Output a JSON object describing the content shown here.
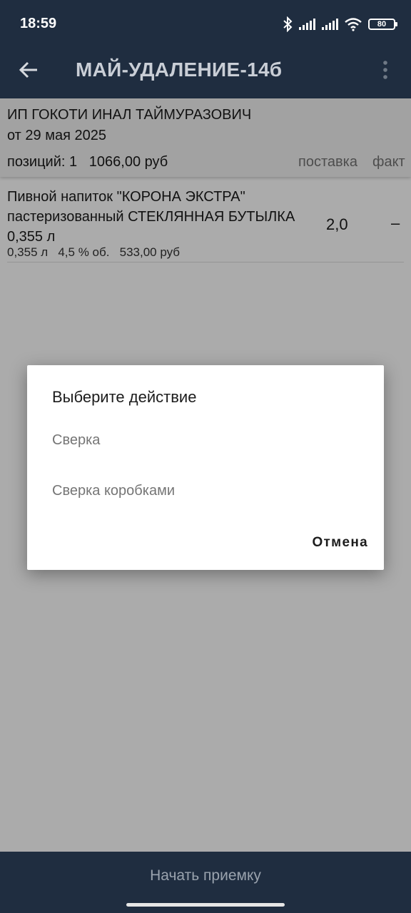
{
  "status_bar": {
    "time": "18:59",
    "battery": "80",
    "icons": [
      "bluetooth-icon",
      "signal-icon",
      "signal-icon",
      "wifi-icon",
      "battery-icon"
    ]
  },
  "app_bar": {
    "title": "МАЙ-УДАЛЕНИЕ-14б",
    "back_icon": "arrow-left-icon",
    "menu_icon": "more-vertical-icon"
  },
  "document": {
    "supplier": "ИП ГОКОТИ ИНАЛ ТАЙМУРАЗОВИЧ",
    "date": "от 29 мая 2025",
    "summary": "позиций: 1   1066,00 руб",
    "column_supply": "поставка",
    "column_fact": "факт"
  },
  "items": [
    {
      "name": "Пивной напиток \"КОРОНА ЭКСТРА\" пастеризованный СТЕКЛЯННАЯ БУТЫЛКА 0,355 л",
      "meta": "0,355 л   4,5 % об.   533,00 руб",
      "qty": "2,0",
      "fact": "–"
    }
  ],
  "dialog": {
    "title": "Выберите действие",
    "options": [
      "Сверка",
      "Сверка коробками"
    ],
    "cancel": "Отмена"
  },
  "bottom": {
    "start_button": "Начать приемку"
  },
  "colors": {
    "bar": "#1f2d40",
    "scrim_background": "#ababab",
    "dialog": "#ffffff"
  }
}
